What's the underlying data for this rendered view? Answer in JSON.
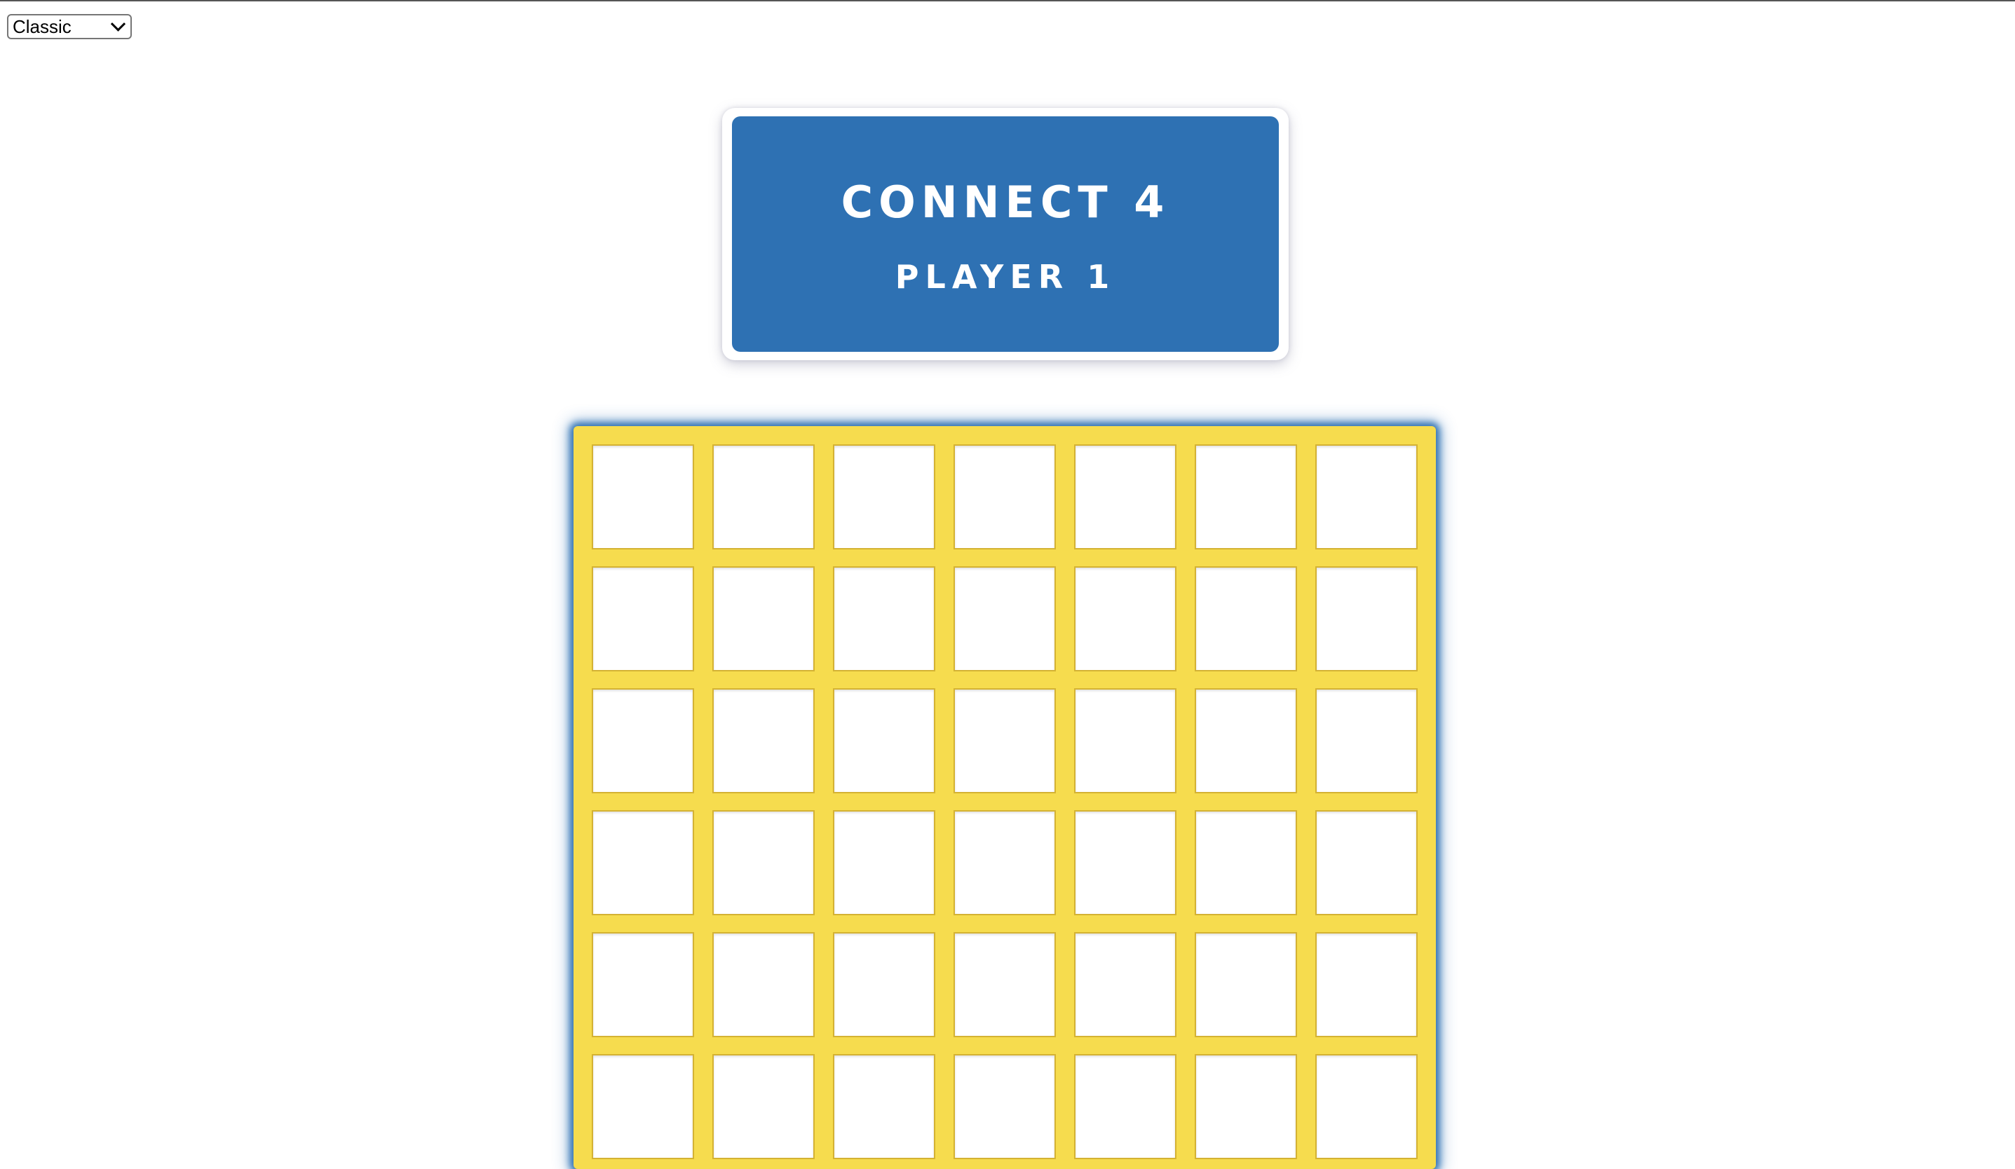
{
  "theme_select": {
    "selected": "Classic"
  },
  "header": {
    "title": "CONNECT 4",
    "turn": "PLAYER 1"
  },
  "board": {
    "rows": 6,
    "columns": 7
  },
  "colors": {
    "header_blue": "#2e71b3",
    "board_yellow": "#f6dc4e",
    "board_glow": "#2e71b3"
  }
}
